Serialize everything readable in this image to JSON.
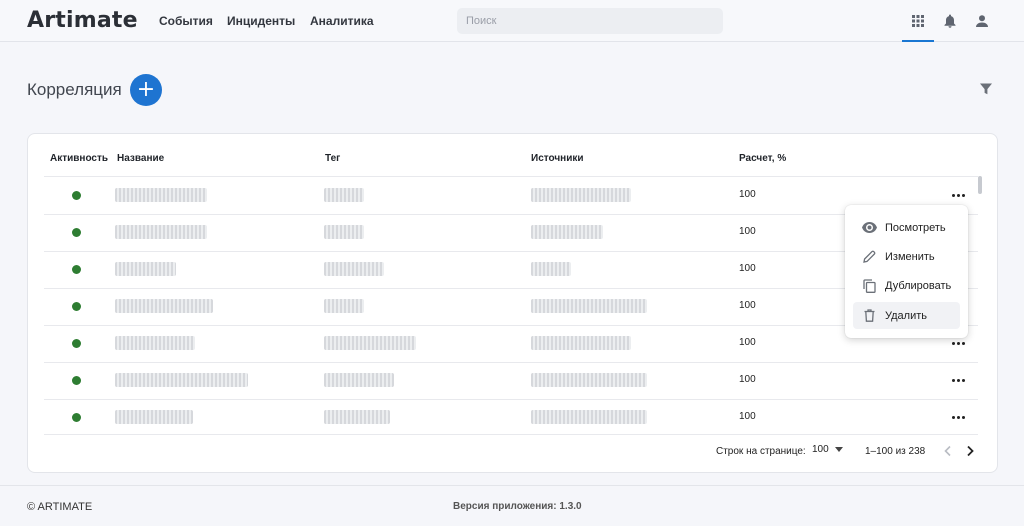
{
  "header": {
    "logo": "Artimate",
    "nav": [
      {
        "label": "События"
      },
      {
        "label": "Инциденты"
      },
      {
        "label": "Аналитика"
      }
    ],
    "search": {
      "placeholder": "Поиск",
      "value": ""
    },
    "icons": [
      "apps-grid-icon",
      "bell-icon",
      "user-icon"
    ]
  },
  "page": {
    "title": "Корреляция",
    "add_label": "+"
  },
  "table": {
    "columns": [
      "Активность",
      "Название",
      "Тег",
      "Источники",
      "Расчет, %"
    ],
    "rows": [
      {
        "active": true,
        "calc": "100"
      },
      {
        "active": true,
        "calc": "100"
      },
      {
        "active": true,
        "calc": "100"
      },
      {
        "active": true,
        "calc": "100"
      },
      {
        "active": true,
        "calc": "100"
      },
      {
        "active": true,
        "calc": "100"
      },
      {
        "active": true,
        "calc": "100"
      }
    ],
    "status_color": "#2e7d32"
  },
  "pagination": {
    "rows_per_page_label": "Строк на странице:",
    "rows_per_page": "100",
    "range": "1–100 из 238"
  },
  "row_menu": {
    "items": [
      {
        "label": "Посмотреть",
        "icon": "eye-icon"
      },
      {
        "label": "Изменить",
        "icon": "pencil-icon"
      },
      {
        "label": "Дублировать",
        "icon": "copy-icon"
      },
      {
        "label": "Удалить",
        "icon": "trash-icon"
      }
    ]
  },
  "footer": {
    "copyright": "© ARTIMATE",
    "version": "Версия приложения: 1.3.0"
  },
  "colors": {
    "accent": "#1e74d1",
    "active_status": "#2e7d32"
  }
}
